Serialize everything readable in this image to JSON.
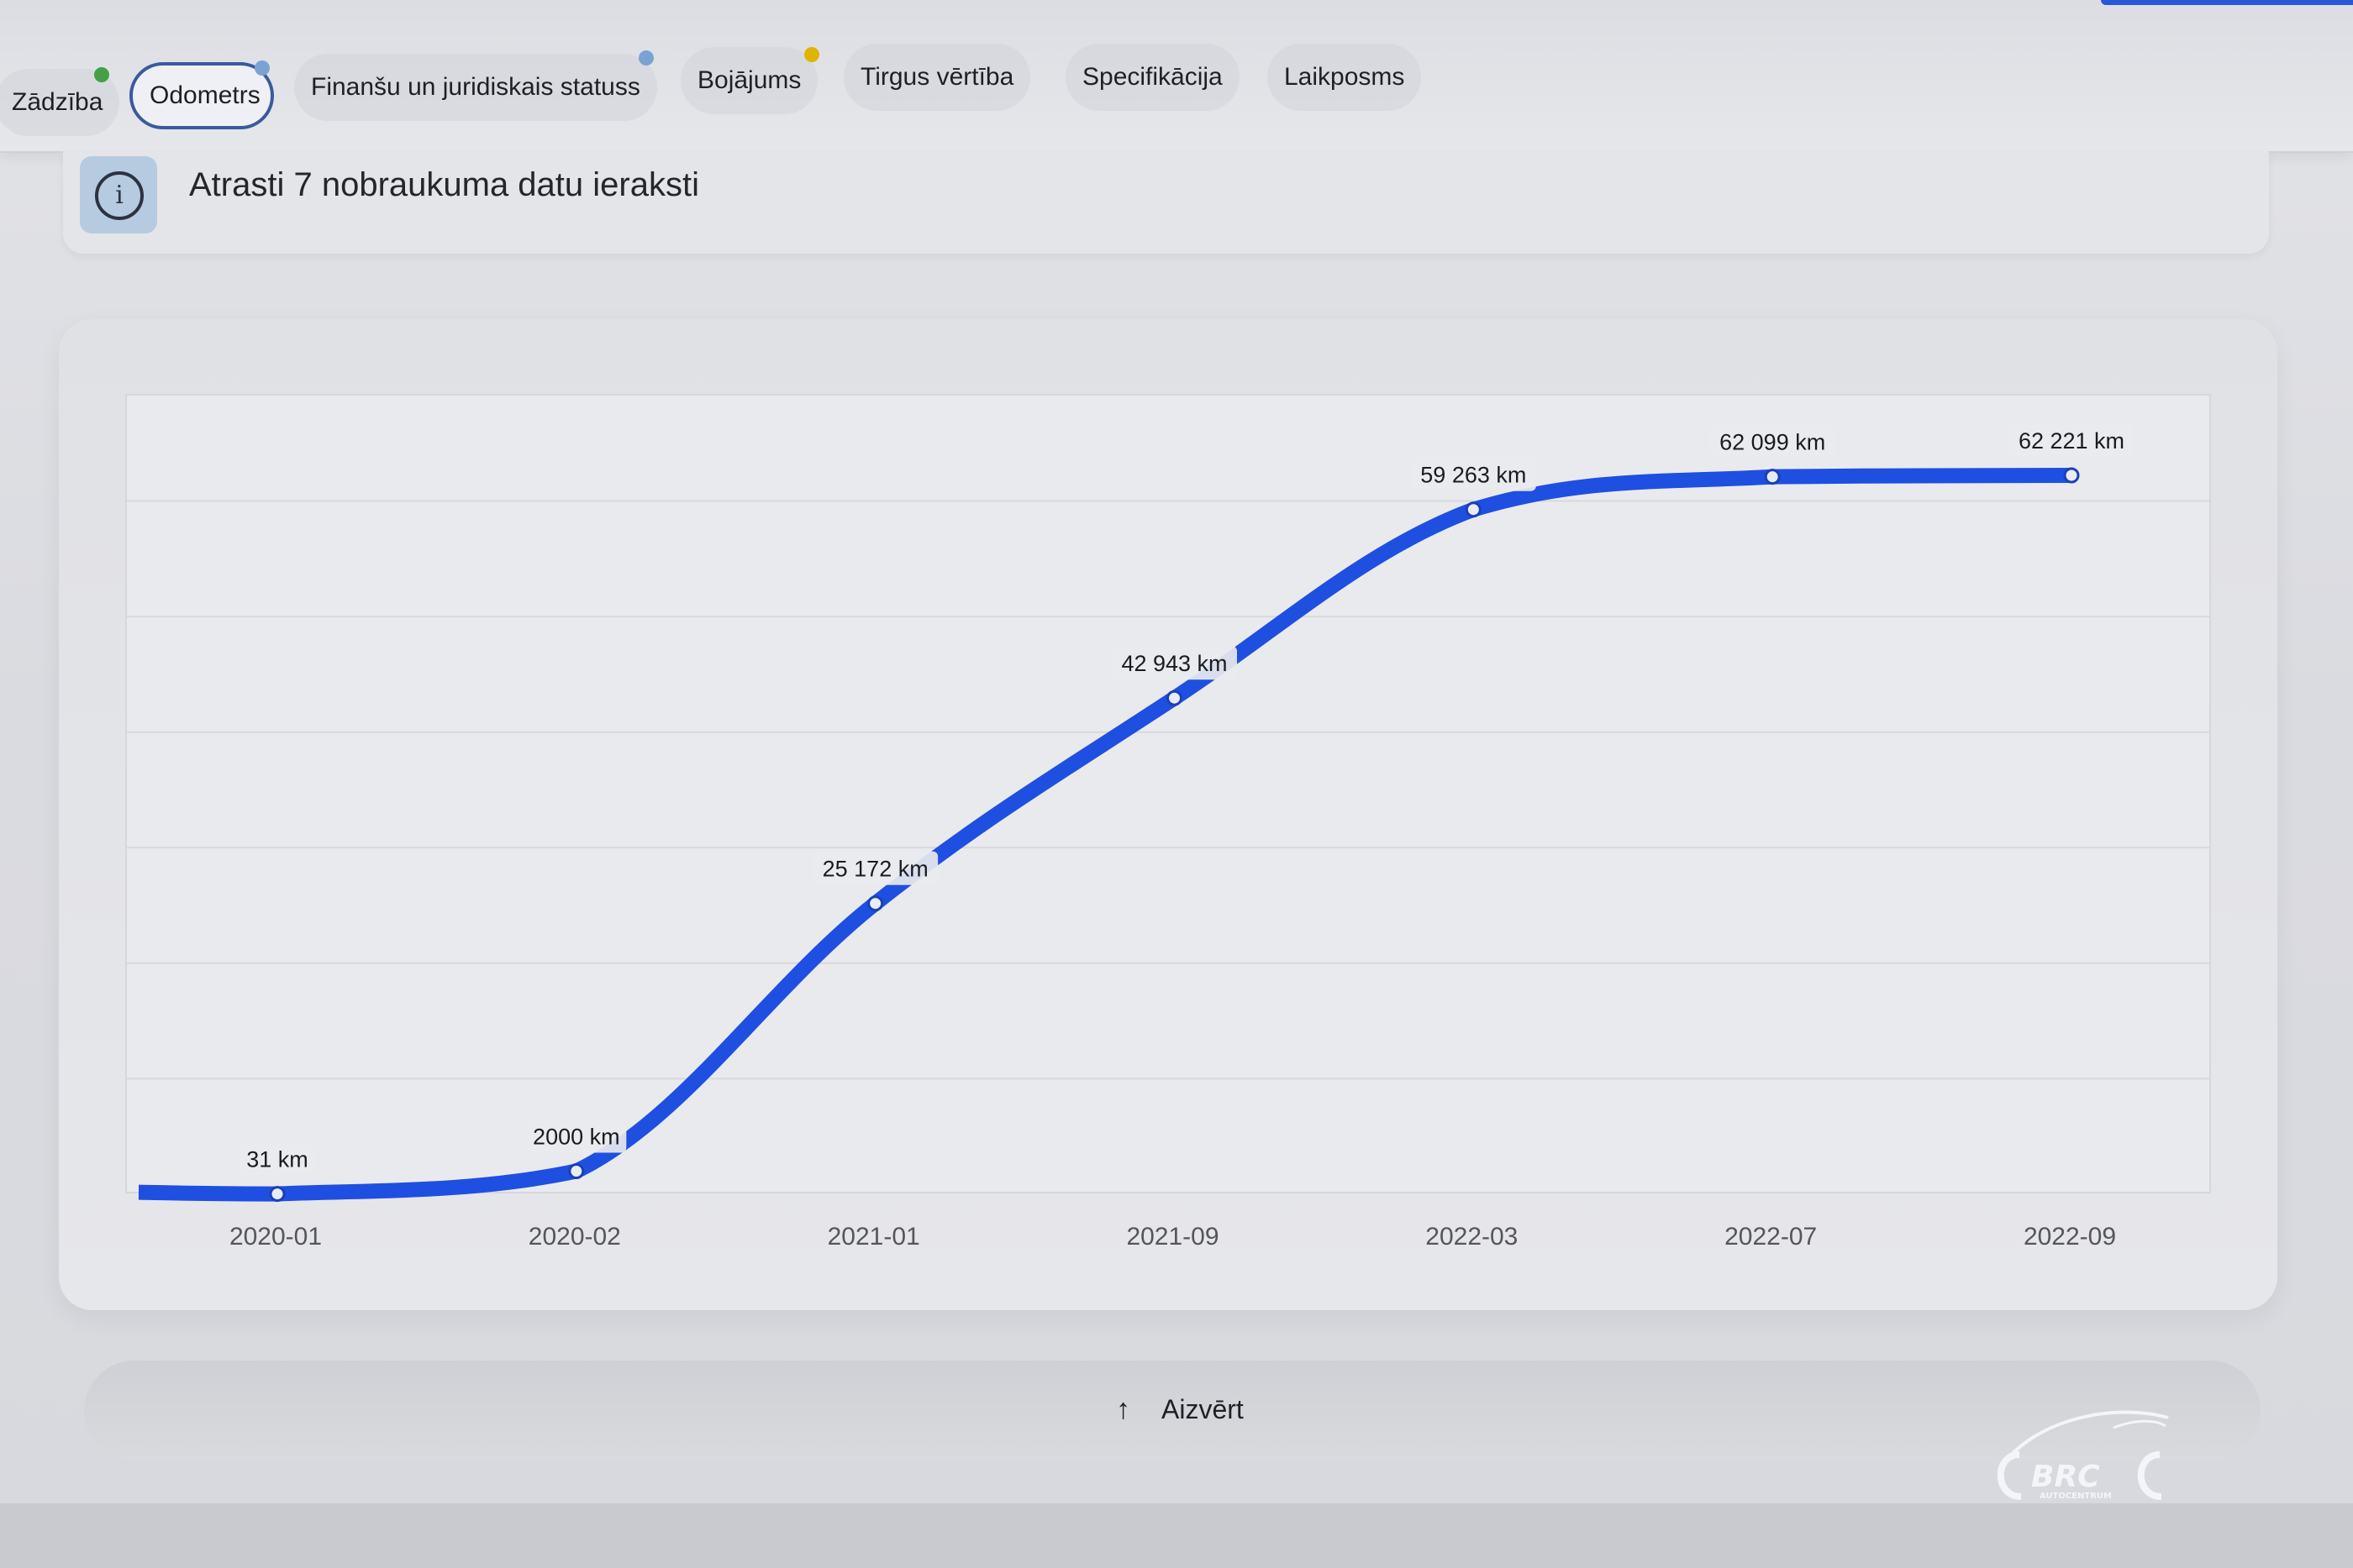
{
  "tabs": [
    {
      "label": "Zādzība",
      "dot_color": "#43a047"
    },
    {
      "label": "Odometrs",
      "dot_color": "#7aa3d4",
      "active": true
    },
    {
      "label": "Finanšu un juridiskais statuss",
      "dot_color": "#7aa3d4"
    },
    {
      "label": "Bojājums",
      "dot_color": "#e0b400"
    },
    {
      "label": "Tirgus vērtība"
    },
    {
      "label": "Specifikācija"
    },
    {
      "label": "Laikposms"
    }
  ],
  "info": {
    "icon": "info-icon",
    "text": "Atrasti 7 nobraukuma datu ieraksti"
  },
  "chart_data": {
    "type": "line",
    "categories": [
      "2020-01",
      "2020-02",
      "2021-01",
      "2021-09",
      "2022-03",
      "2022-07",
      "2022-09"
    ],
    "values": [
      31,
      2000,
      25172,
      42943,
      59263,
      62099,
      62221
    ],
    "data_labels": [
      "31 km",
      "2000 km",
      "25 172 km",
      "42 943 km",
      "59 263 km",
      "62 099 km",
      "62 221 km"
    ],
    "unit": "km",
    "ylim": [
      0,
      70000
    ],
    "grid": true,
    "line_color": "#1f4fe0",
    "smooth": true
  },
  "close_button": {
    "icon": "arrow-up-icon",
    "label": "Aizvērt"
  },
  "logo": {
    "text": "BRC",
    "subtext": "AUTOCENTRUM"
  }
}
